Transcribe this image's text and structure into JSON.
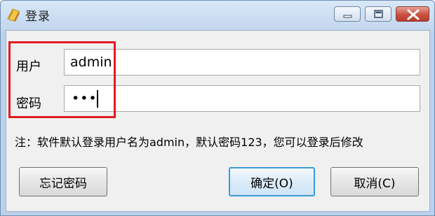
{
  "window": {
    "title": "登录",
    "icon": "app-icon",
    "controls": {
      "minimize": "minimize-icon",
      "maximize": "maximize-icon",
      "close": "close-icon"
    }
  },
  "form": {
    "username_label": "用户",
    "username_value": "admin",
    "password_label": "密码",
    "password_mask": "•••"
  },
  "note": "注：软件默认登录用户名为admin，默认密码123，您可以登录后修改",
  "buttons": {
    "forgot": "忘记密码",
    "ok": "确定(O)",
    "cancel": "取消(C)"
  },
  "colors": {
    "highlight": "#e21b23",
    "titlebar": "#c3d7ee",
    "close_button": "#c8513f",
    "default_button_border": "#3c9ad7"
  }
}
